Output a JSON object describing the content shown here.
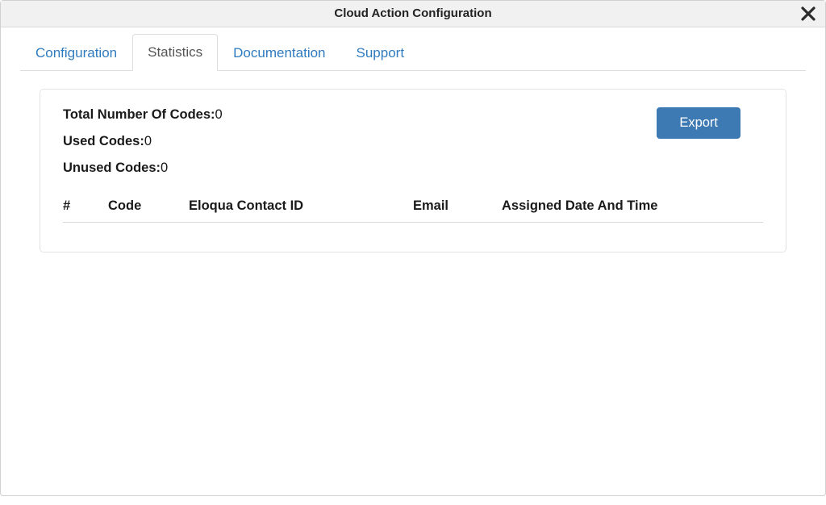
{
  "header": {
    "title": "Cloud Action Configuration"
  },
  "tabs": {
    "configuration": "Configuration",
    "statistics": "Statistics",
    "documentation": "Documentation",
    "support": "Support"
  },
  "stats": {
    "total_label": "Total Number Of Codes:",
    "total_value": "0",
    "used_label": "Used Codes:",
    "used_value": "0",
    "unused_label": "Unused Codes:",
    "unused_value": "0"
  },
  "actions": {
    "export": "Export"
  },
  "table": {
    "columns": {
      "num": "#",
      "code": "Code",
      "contact": "Eloqua Contact ID",
      "email": "Email",
      "date": "Assigned Date And Time"
    },
    "rows": []
  }
}
